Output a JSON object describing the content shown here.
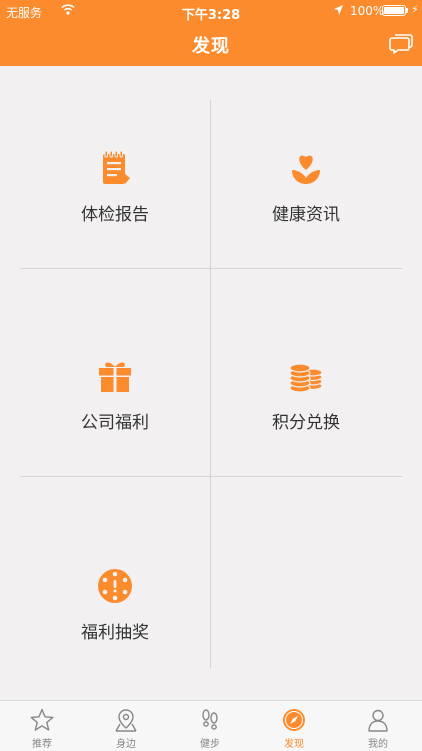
{
  "status_bar": {
    "carrier": "无服务",
    "time": "下午3:28",
    "battery": "100%"
  },
  "nav": {
    "title": "发现"
  },
  "grid": {
    "items": [
      {
        "label": "体检报告",
        "icon": "notepad-icon"
      },
      {
        "label": "健康资讯",
        "icon": "heart-flower-icon"
      },
      {
        "label": "公司福利",
        "icon": "gift-icon"
      },
      {
        "label": "积分兑换",
        "icon": "coins-stack-icon"
      },
      {
        "label": "福利抽奖",
        "icon": "lottery-wheel-icon"
      }
    ]
  },
  "tabbar": {
    "items": [
      {
        "label": "推荐",
        "icon": "star-icon"
      },
      {
        "label": "身边",
        "icon": "map-pin-icon"
      },
      {
        "label": "健步",
        "icon": "footprints-icon"
      },
      {
        "label": "发现",
        "icon": "compass-icon",
        "active": true
      },
      {
        "label": "我的",
        "icon": "person-icon"
      }
    ]
  },
  "colors": {
    "accent": "#fb8b2c",
    "background": "#f2f0f1"
  }
}
